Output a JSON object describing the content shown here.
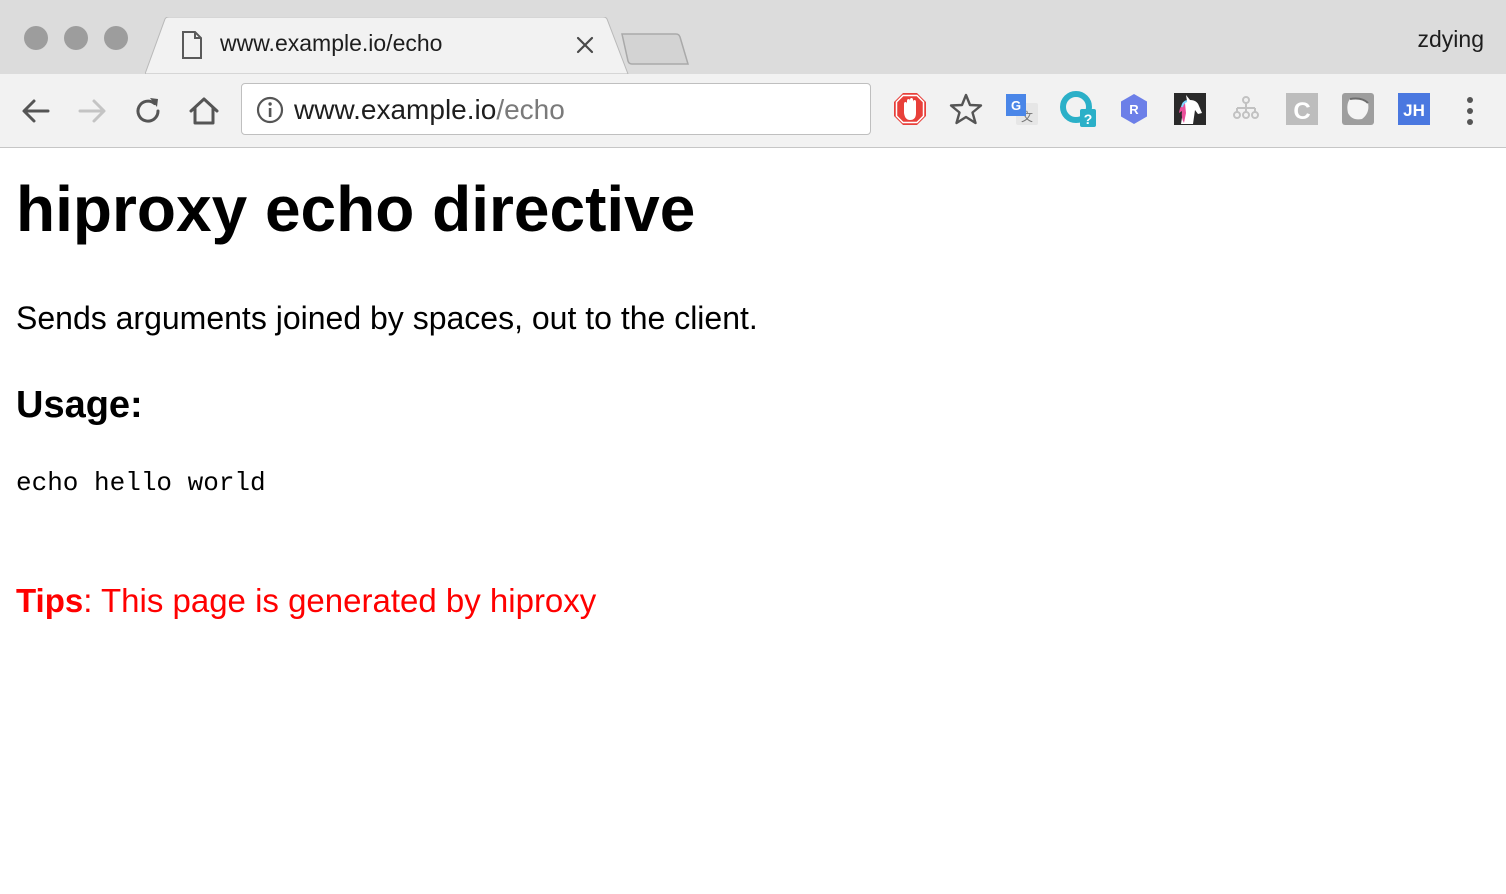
{
  "window": {
    "profile_name": "zdying"
  },
  "tab": {
    "title": "www.example.io/echo",
    "icon": "page-icon"
  },
  "toolbar": {
    "back_icon": "back-arrow-icon",
    "forward_icon": "forward-arrow-icon",
    "reload_icon": "reload-icon",
    "home_icon": "home-icon",
    "omnibox": {
      "host": "www.example.io",
      "path": "/echo",
      "info_icon": "info-icon"
    },
    "extensions": [
      {
        "name": "adblock-icon"
      },
      {
        "name": "bookmark-star-icon"
      },
      {
        "name": "google-translate-icon"
      },
      {
        "name": "help-extension-icon"
      },
      {
        "name": "r-hexagon-icon",
        "letter": "R"
      },
      {
        "name": "unicorn-icon"
      },
      {
        "name": "sitemap-icon"
      },
      {
        "name": "c-extension-icon",
        "letter": "C"
      },
      {
        "name": "gray-square-icon"
      },
      {
        "name": "jh-extension-icon",
        "letter": "JH"
      }
    ],
    "menu_icon": "more-vert-icon"
  },
  "page": {
    "title": "hiproxy echo directive",
    "description": "Sends arguments joined by spaces, out to the client.",
    "usage_heading": "Usage:",
    "code": "echo hello world",
    "tips_label": "Tips",
    "tips_text": ": This page is generated by hiproxy"
  },
  "colors": {
    "tab_strip": "#dcdcdc",
    "toolbar": "#f2f2f2",
    "tips_red": "#ff0000",
    "adblock_red": "#e8403a",
    "translate_blue": "#4a86e8",
    "help_teal": "#2bb0c8",
    "r_purple": "#6c7fe8",
    "jh_blue": "#4a78e0"
  }
}
